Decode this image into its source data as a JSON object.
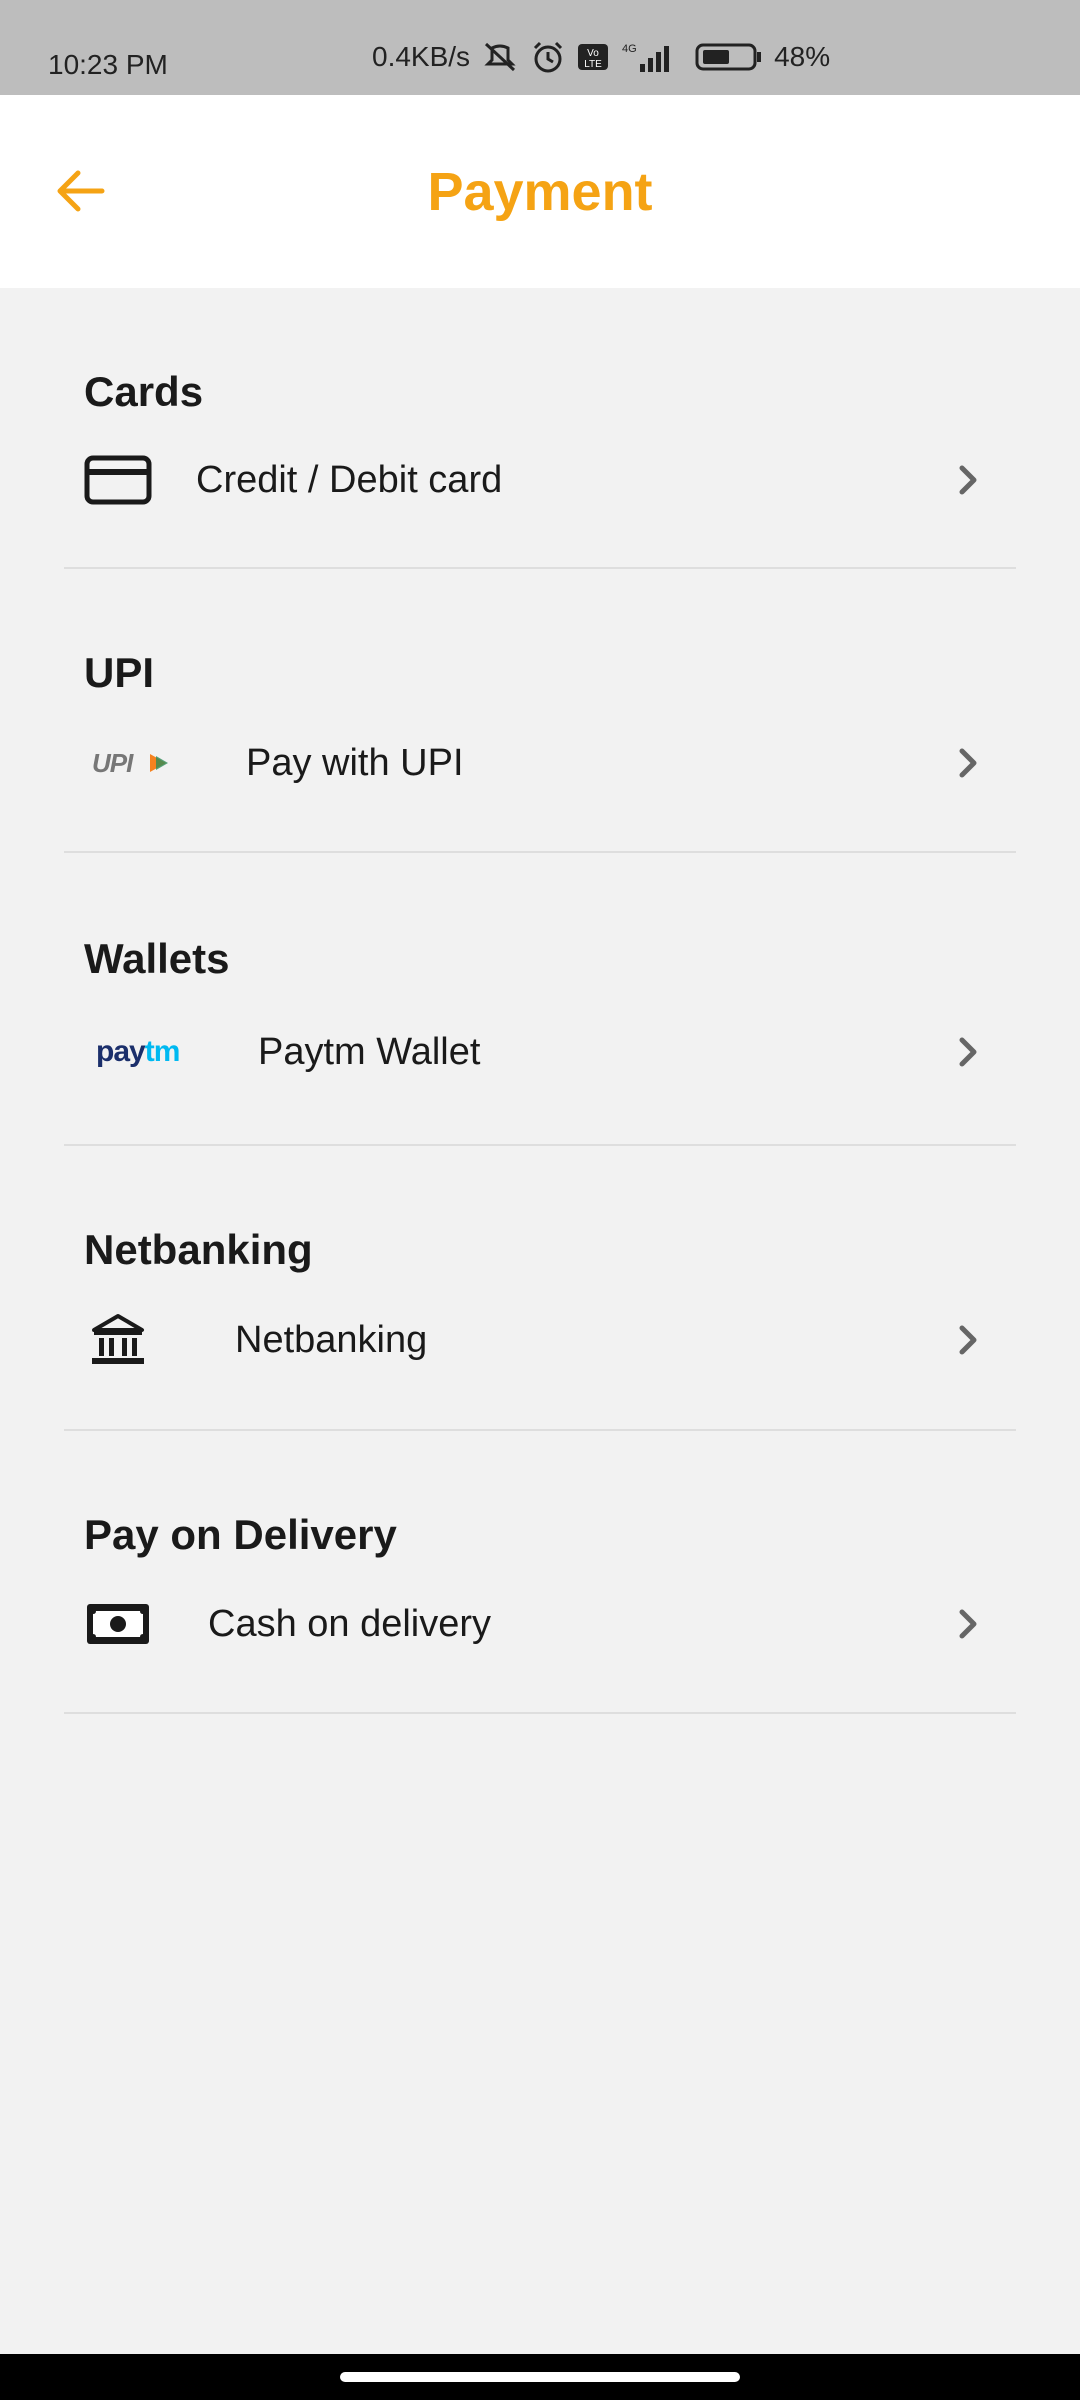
{
  "status": {
    "time": "10:23 PM",
    "speed": "0.4KB/s",
    "network": "4G",
    "battery": "48%"
  },
  "header": {
    "title": "Payment",
    "accent": "#f5a314"
  },
  "sections": [
    {
      "title": "Cards",
      "item": "Credit / Debit card",
      "icon": "credit-card-icon"
    },
    {
      "title": "UPI",
      "item": "Pay with UPI",
      "icon": "upi-logo"
    },
    {
      "title": "Wallets",
      "item": "Paytm Wallet",
      "icon": "paytm-logo",
      "logo_text": "paytm"
    },
    {
      "title": "Netbanking",
      "item": "Netbanking",
      "icon": "bank-icon"
    },
    {
      "title": "Pay on Delivery",
      "item": "Cash on delivery",
      "icon": "cash-icon"
    }
  ]
}
